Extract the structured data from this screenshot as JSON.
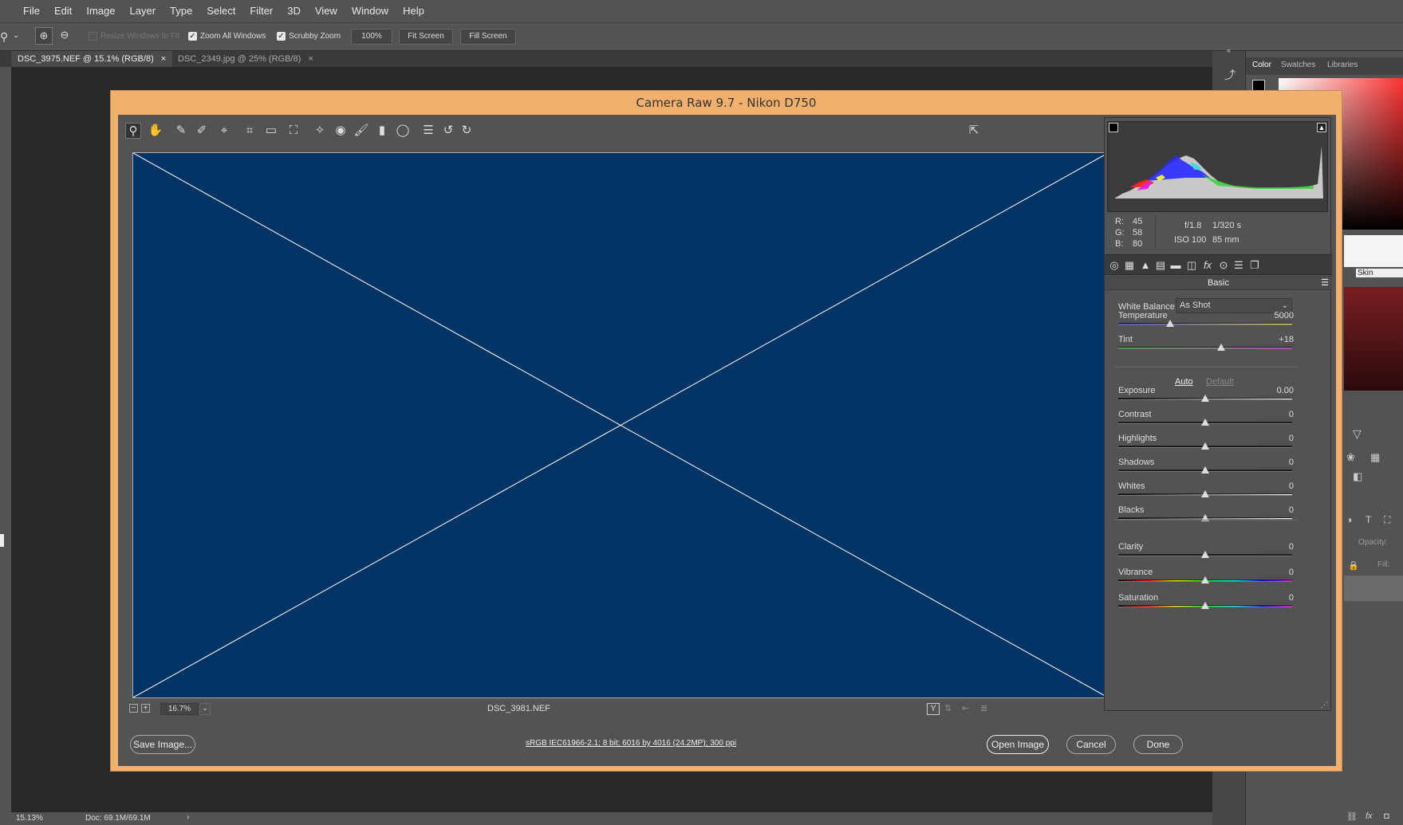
{
  "menu": [
    "File",
    "Edit",
    "Image",
    "Layer",
    "Type",
    "Select",
    "Filter",
    "3D",
    "View",
    "Window",
    "Help"
  ],
  "options": {
    "resize_windows": "Resize Windows to Fit",
    "zoom_all": "Zoom All Windows",
    "scrubby": "Scrubby Zoom",
    "zoom_value": "100%",
    "fit_screen": "Fit Screen",
    "fill_screen": "Fill Screen"
  },
  "doc_tabs": [
    {
      "label": "DSC_3975.NEF @ 15.1% (RGB/8)",
      "close": "×"
    },
    {
      "label": "DSC_2349.jpg @ 25% (RGB/8)",
      "close": "×"
    }
  ],
  "panels": {
    "tabs": [
      "Color",
      "Swatches",
      "Libraries"
    ],
    "opacity_label": "Opacity:",
    "fill_label": "Fill:",
    "skin": "Skin"
  },
  "status": {
    "zoom": "15.13%",
    "doc": "Doc: 69.1M/69.1M"
  },
  "dialog": {
    "title": "Camera Raw 9.7  -  Nikon D750",
    "filename": "DSC_3981.NEF",
    "zoom": "16.7%",
    "workflow": "sRGB IEC61966-2.1; 8 bit; 6016 by 4016 (24.2MP); 300 ppi",
    "save_image": "Save Image...",
    "open_image": "Open Image",
    "cancel": "Cancel",
    "done": "Done",
    "preview_color": "#013465"
  },
  "info": {
    "r_label": "R:",
    "r": "45",
    "g_label": "G:",
    "g": "58",
    "b_label": "B:",
    "b": "80",
    "aperture": "f/1.8",
    "shutter": "1/320 s",
    "iso": "ISO 100",
    "focal": "85 mm"
  },
  "basic": {
    "header": "Basic",
    "wb_label": "White Balance:",
    "wb_value": "As Shot",
    "auto": "Auto",
    "default": "Default",
    "sliders": [
      {
        "label": "Temperature",
        "value": "5000",
        "pos": 0.3
      },
      {
        "label": "Tint",
        "value": "+18",
        "pos": 0.59
      },
      {
        "label": "Exposure",
        "value": "0.00",
        "pos": 0.5
      },
      {
        "label": "Contrast",
        "value": "0",
        "pos": 0.5
      },
      {
        "label": "Highlights",
        "value": "0",
        "pos": 0.5
      },
      {
        "label": "Shadows",
        "value": "0",
        "pos": 0.5
      },
      {
        "label": "Whites",
        "value": "0",
        "pos": 0.5
      },
      {
        "label": "Blacks",
        "value": "0",
        "pos": 0.5
      },
      {
        "label": "Clarity",
        "value": "0",
        "pos": 0.5
      },
      {
        "label": "Vibrance",
        "value": "0",
        "pos": 0.5
      },
      {
        "label": "Saturation",
        "value": "0",
        "pos": 0.5
      }
    ]
  }
}
